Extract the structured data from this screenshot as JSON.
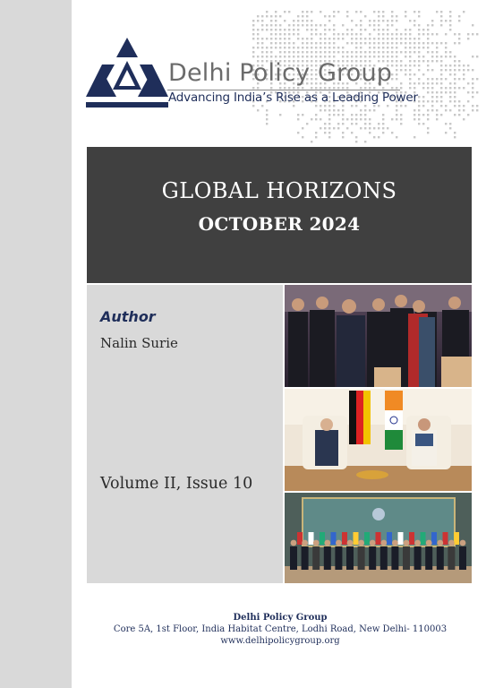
{
  "header": {
    "org_name": "Delhi Policy Group",
    "tagline": "Advancing India’s Rise as a Leading Power"
  },
  "title_panel": {
    "title": "GLOBAL HORIZONS",
    "subtitle": "OCTOBER 2024"
  },
  "info_panel": {
    "author_label": "Author",
    "author_name": "Nalin Surie",
    "volume": "Volume II, Issue 10"
  },
  "footer": {
    "org_name": "Delhi Policy Group",
    "address": "Core 5A, 1st Floor, India Habitat Centre, Lodhi Road, New Delhi- 110003",
    "website": "www.delhipolicygroup.org"
  },
  "colors": {
    "navy": "#1f2e5a",
    "panel_dark": "#404040",
    "panel_light": "#d9d9d9",
    "logo_gray": "#6b6b6b"
  }
}
